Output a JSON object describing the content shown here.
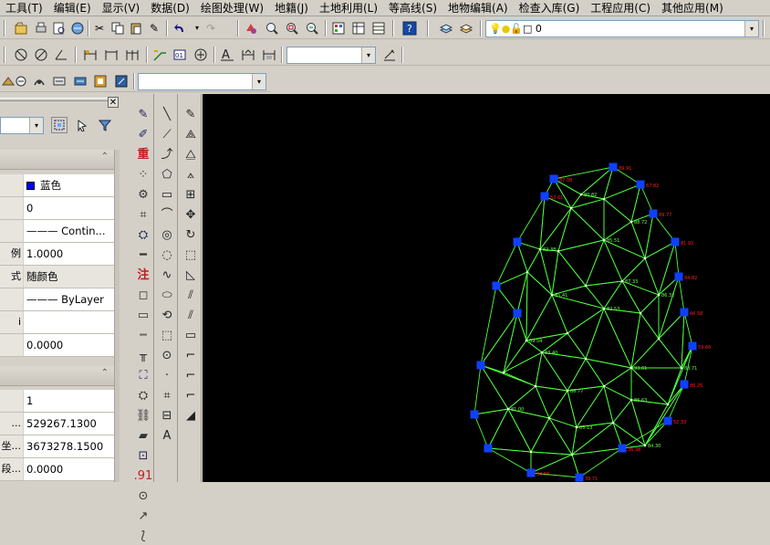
{
  "menu": [
    "工具(T)",
    "编辑(E)",
    "显示(V)",
    "数据(D)",
    "绘图处理(W)",
    "地籍(J)",
    "土地利用(L)",
    "等高线(S)",
    "地物编辑(A)",
    "检查入库(G)",
    "工程应用(C)",
    "其他应用(M)"
  ],
  "toolbar": {
    "layer_value": "0",
    "color_value": "",
    "linetype_value": "",
    "text_style_value": "",
    "icons_row1": [
      "open-icon",
      "print-icon",
      "preview-icon",
      "publish-icon",
      "cut-icon",
      "copy-icon",
      "paste-icon",
      "match-prop-icon",
      "undo-icon",
      "redo-icon",
      "pan-icon",
      "zoom-realtime-icon",
      "zoom-window-icon",
      "zoom-prev-icon",
      "properties-icon",
      "design-center-icon",
      "tool-palette-icon",
      "help-icon",
      "layer-manager-icon",
      "layer-state-icon"
    ],
    "icons_row2": [
      "snap-icon",
      "circle-slash-icon",
      "angle-icon",
      "dim-linear-icon",
      "dim-aligned-icon",
      "dim-baseline-icon",
      "leader-icon",
      "dim-radius-icon",
      "dim-center-icon",
      "text-style-icon",
      "dim-edit-icon",
      "dim-style-icon"
    ],
    "icons_row3": [
      "tool-a-icon",
      "tool-b-icon",
      "tool-c-icon",
      "tool-d-icon",
      "tool-e-icon",
      "tool-f-icon",
      "tool-g-icon"
    ],
    "dropdown_arrow": "▾"
  },
  "properties": {
    "close_glyph": "✕",
    "section_general_collapse": "⌃",
    "section_geometry_collapse": "⌃",
    "rows_general": [
      {
        "key": "",
        "value": "蓝色",
        "swatch": "#0000ff"
      },
      {
        "key": "",
        "value": "0"
      },
      {
        "key": "",
        "value": "——— Contin..."
      },
      {
        "key": "例",
        "value": "1.0000"
      },
      {
        "key": "式",
        "value": "随颜色"
      },
      {
        "key": "",
        "value": "——— ByLayer"
      },
      {
        "key": "i",
        "value": ""
      },
      {
        "key": "",
        "value": "0.0000"
      }
    ],
    "rows_geometry": [
      {
        "key": "",
        "value": "1"
      },
      {
        "key": "...",
        "value": "529267.1300"
      },
      {
        "key": "坐...",
        "value": "3673278.1500"
      },
      {
        "key": "段...",
        "value": "0.0000"
      }
    ]
  },
  "draw_tools_glyphs": {
    "col1": [
      "✎",
      "✐",
      "重",
      "⁘",
      "⚙",
      "⌗",
      "⛭",
      "━",
      "注",
      "◻",
      "▭",
      "┉",
      "╥",
      "⛶",
      "⛭",
      "⛓",
      "▰",
      "⊡",
      ".91",
      "⊙",
      "↗",
      "⟅"
    ],
    "col2": [
      "╲",
      "⟋",
      "⤴",
      "⬠",
      "▭",
      "⌒",
      "◎",
      "◌",
      "∿",
      "⬭",
      "⟲",
      "⬚",
      "⊙",
      "·",
      "⌗",
      "⊟",
      "A"
    ],
    "col3": [
      "✎",
      "⟁",
      "⧋",
      "⟑",
      "⊞",
      "✥",
      "↻",
      "⬚",
      "◺",
      "⫽",
      "⫽",
      "▭",
      "⌐",
      "⌐",
      "⌐",
      "◢"
    ],
    "text_tool": "A"
  },
  "canvas": {
    "background": "#000000",
    "network_color": "#4cff3c",
    "station_color": "#1040ff",
    "label_red": "#ff2020",
    "label_green": "#70ff50",
    "red_labels": [
      "89.91",
      "87.08",
      "53.61",
      "67.82",
      "89.77",
      "81.92",
      "84.82",
      "66.58",
      "59.66",
      "86.25",
      "52.33",
      "36.38",
      "39.71",
      "34.55"
    ],
    "green_labels": [
      "80.82",
      "88.72",
      "85.51",
      "82.38",
      "87.33",
      "85.41",
      "86.32",
      "82.53",
      "89.54",
      "83.40",
      "93.61",
      "83.71",
      "86.63",
      "86.77",
      "81.00",
      "85.13",
      "84.30"
    ]
  }
}
